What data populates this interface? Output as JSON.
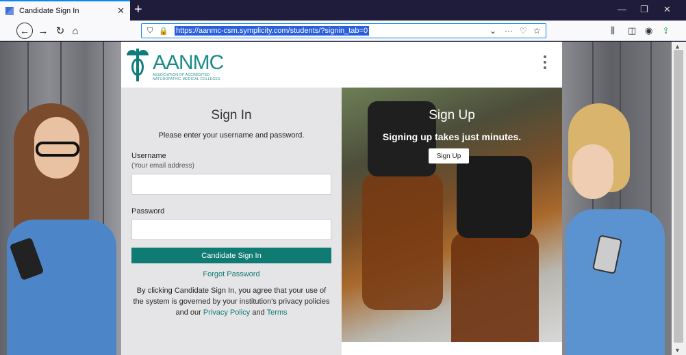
{
  "browser": {
    "tab_title": "Candidate Sign In",
    "tab_close": "✕",
    "new_tab": "+",
    "url": "https://aanmc-csm.symplicity.com/students/?signin_tab=0"
  },
  "header": {
    "logo_title": "AANMC",
    "logo_sub_1": "ASSOCIATION OF ACCREDITED",
    "logo_sub_2": "NATUROPATHIC MEDICAL COLLEGES"
  },
  "signin": {
    "title": "Sign In",
    "instructions": "Please enter your username and password.",
    "username_label": "Username",
    "username_hint": "(Your email address)",
    "username_value": "",
    "password_label": "Password",
    "password_value": "",
    "submit_label": "Candidate Sign In",
    "forgot_label": "Forgot Password",
    "disclaimer_prefix": "By clicking Candidate Sign In, you agree that your use of the system is governed by your institution's privacy policies and our ",
    "privacy_label": "Privacy Policy",
    "and_text": " and ",
    "terms_label": "Terms"
  },
  "signup": {
    "title": "Sign Up",
    "subtitle": "Signing up takes just minutes.",
    "button_label": "Sign Up"
  },
  "colors": {
    "accent": "#0f7b72",
    "logo": "#1c8a8a",
    "url_highlight": "#2a5fdb"
  },
  "icons": [
    "back-arrow-icon",
    "forward-arrow-icon",
    "reload-icon",
    "home-icon",
    "shield-icon",
    "lock-icon",
    "chevron-down-icon",
    "more-icon",
    "pocket-icon",
    "star-icon",
    "library-icon",
    "sidebar-icon",
    "account-icon",
    "extension-icon",
    "kebab-menu-icon"
  ]
}
